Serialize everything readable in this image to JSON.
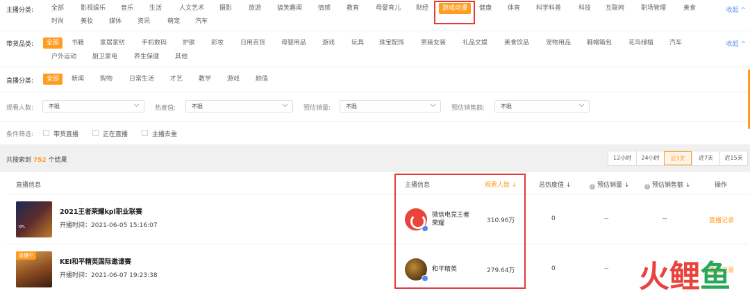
{
  "anchor_category": {
    "label": "主播分类:",
    "row1": [
      "全部",
      "影视娱乐",
      "音乐",
      "生活",
      "人文艺术",
      "摄影",
      "旅游",
      "搞笑趣闻",
      "情感",
      "教育",
      "母婴育儿",
      "财经",
      "游戏动漫",
      "健康",
      "体育",
      "科学科普",
      "科技",
      "互联网",
      "职场管理",
      "美食"
    ],
    "row2": [
      "时尚",
      "美妆",
      "媒体",
      "资讯",
      "萌宠",
      "汽车"
    ],
    "active": "游戏动漫",
    "collapse": "收起 ^"
  },
  "goods_category": {
    "label": "带货品类:",
    "row1": [
      "全部",
      "书籍",
      "家居家纺",
      "手机数码",
      "护肤",
      "彩妆",
      "日用百货",
      "母婴用品",
      "游戏",
      "玩具",
      "珠宝配饰",
      "男装女装",
      "礼品文娱",
      "美食饮品",
      "宠物用品",
      "鞋帽箱包",
      "花鸟绿植",
      "汽车"
    ],
    "row2": [
      "户外运动",
      "厨卫家电",
      "养生保健",
      "其他"
    ],
    "active": "全部",
    "collapse": "收起 ^"
  },
  "live_category": {
    "label": "直播分类:",
    "items": [
      "全部",
      "新闻",
      "购物",
      "日常生活",
      "才艺",
      "教学",
      "游戏",
      "颜值"
    ],
    "active": "全部"
  },
  "selects": [
    {
      "label": "观看人数:",
      "value": "不限"
    },
    {
      "label": "热度值:",
      "value": "不限"
    },
    {
      "label": "预估销量:",
      "value": "不限"
    },
    {
      "label": "预估销售额:",
      "value": "不限"
    }
  ],
  "conditions": {
    "label": "条件筛选:",
    "options": [
      "带货直播",
      "正在直播",
      "主播去重"
    ]
  },
  "results": {
    "prefix": "共搜索到",
    "count": "752",
    "suffix": "个结果"
  },
  "time_tabs": [
    "12小时",
    "24小时",
    "近3天",
    "近7天",
    "近15天"
  ],
  "time_active": "近3天",
  "table": {
    "headers": {
      "live_info": "直播信息",
      "anchor_info": "主播信息",
      "viewers": "观看人数 ↓",
      "heat": "总热度值 ↓",
      "sales_qty": "预估销量 ↓",
      "sales_amt": "预估销售额 ↓",
      "action": "操作"
    },
    "rows": [
      {
        "title": "2021王者荣耀kpl职业联赛",
        "start_time": "开播时间：2021-06-05 15:16:07",
        "anchor": "微信电竞王者荣耀",
        "viewers": "310.96万",
        "heat": "0",
        "sales_qty": "--",
        "sales_amt": "--",
        "action": "直播记录",
        "live": ""
      },
      {
        "title": "KEI和平精英国际邀请赛",
        "start_time": "开播时间：2021-06-07 19:23:38",
        "anchor": "和平精英",
        "viewers": "279.64万",
        "heat": "0",
        "sales_qty": "--",
        "sales_amt": "--",
        "action": "直播记录",
        "live": "直播中"
      }
    ]
  },
  "watermark": [
    "火",
    "鲤",
    "鱼"
  ],
  "colors": {
    "accent": "#ff9c21",
    "highlight": "#e03a3a",
    "link": "#5a8ef0"
  }
}
